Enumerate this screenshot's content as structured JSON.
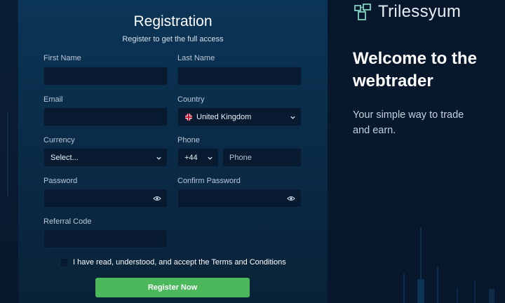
{
  "form": {
    "title": "Registration",
    "subtitle": "Register to get the full access",
    "first_name_label": "First Name",
    "last_name_label": "Last Name",
    "email_label": "Email",
    "country_label": "Country",
    "country_value": "United Kingdom",
    "currency_label": "Currency",
    "currency_value": "Select...",
    "phone_label": "Phone",
    "phone_code": "+44",
    "phone_placeholder": "Phone",
    "password_label": "Password",
    "confirm_password_label": "Confirm Password",
    "referral_label": "Referral Code",
    "terms_text": "I have read, understood, and accept the Terms and Conditions",
    "submit_label": "Register Now"
  },
  "brand": {
    "name": "Trilessyum",
    "welcome": "Welcome to the webtrader",
    "tagline": "Your simple way to trade and earn."
  },
  "colors": {
    "accent": "#4cb85c",
    "panel": "#0b3557",
    "background": "#07162a",
    "logo": "#7fd3c0"
  }
}
